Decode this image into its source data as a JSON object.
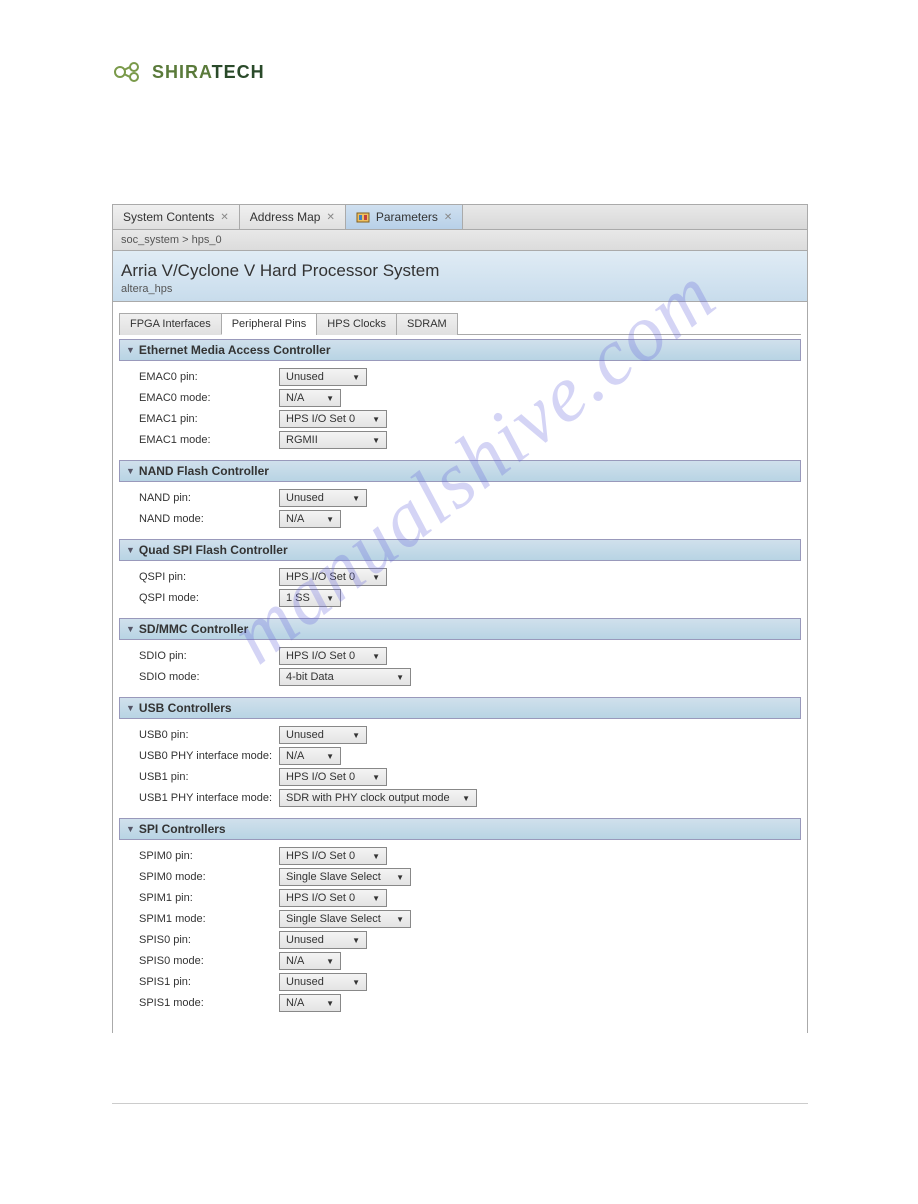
{
  "logo": {
    "text1": "SHIRA",
    "text2": "TECH"
  },
  "tabs": [
    {
      "label": "System Contents",
      "active": false
    },
    {
      "label": "Address Map",
      "active": false
    },
    {
      "label": "Parameters",
      "active": true
    }
  ],
  "breadcrumb": "soc_system > hps_0",
  "title": "Arria V/Cyclone V Hard Processor System",
  "subtitle": "altera_hps",
  "subTabs": [
    {
      "label": "FPGA Interfaces",
      "active": false
    },
    {
      "label": "Peripheral Pins",
      "active": true
    },
    {
      "label": "HPS Clocks",
      "active": false
    },
    {
      "label": "SDRAM",
      "active": false
    }
  ],
  "sections": [
    {
      "title": "Ethernet Media Access Controller",
      "rows": [
        {
          "label": "EMAC0 pin:",
          "value": "Unused",
          "w": "w1"
        },
        {
          "label": "EMAC0 mode:",
          "value": "N/A",
          "w": ""
        },
        {
          "label": "EMAC1 pin:",
          "value": "HPS I/O Set 0",
          "w": "w2"
        },
        {
          "label": "EMAC1 mode:",
          "value": "RGMII",
          "w": "w2"
        }
      ]
    },
    {
      "title": "NAND Flash Controller",
      "rows": [
        {
          "label": "NAND pin:",
          "value": "Unused",
          "w": "w1"
        },
        {
          "label": "NAND mode:",
          "value": "N/A",
          "w": ""
        }
      ]
    },
    {
      "title": "Quad SPI Flash Controller",
      "rows": [
        {
          "label": "QSPI pin:",
          "value": "HPS I/O Set 0",
          "w": "w2"
        },
        {
          "label": "QSPI mode:",
          "value": "1 SS",
          "w": ""
        }
      ]
    },
    {
      "title": "SD/MMC Controller",
      "rows": [
        {
          "label": "SDIO pin:",
          "value": "HPS I/O Set 0",
          "w": "w2"
        },
        {
          "label": "SDIO mode:",
          "value": "4-bit Data",
          "w": "w3"
        }
      ]
    },
    {
      "title": "USB Controllers",
      "rows": [
        {
          "label": "USB0 pin:",
          "value": "Unused",
          "w": "w1"
        },
        {
          "label": "USB0 PHY interface mode:",
          "value": "N/A",
          "w": ""
        },
        {
          "label": "USB1 pin:",
          "value": "HPS I/O Set 0",
          "w": "w2"
        },
        {
          "label": "USB1 PHY interface mode:",
          "value": "SDR with PHY clock output mode",
          "w": "w4"
        }
      ]
    },
    {
      "title": "SPI Controllers",
      "rows": [
        {
          "label": "SPIM0 pin:",
          "value": "HPS I/O Set 0",
          "w": "w2"
        },
        {
          "label": "SPIM0 mode:",
          "value": "Single Slave Select",
          "w": "w3"
        },
        {
          "label": "SPIM1 pin:",
          "value": "HPS I/O Set 0",
          "w": "w2"
        },
        {
          "label": "SPIM1 mode:",
          "value": "Single Slave Select",
          "w": "w3"
        },
        {
          "label": "SPIS0 pin:",
          "value": "Unused",
          "w": "w1"
        },
        {
          "label": "SPIS0 mode:",
          "value": "N/A",
          "w": ""
        },
        {
          "label": "SPIS1 pin:",
          "value": "Unused",
          "w": "w1"
        },
        {
          "label": "SPIS1 mode:",
          "value": "N/A",
          "w": ""
        }
      ]
    }
  ],
  "watermark": "manualshive.com"
}
